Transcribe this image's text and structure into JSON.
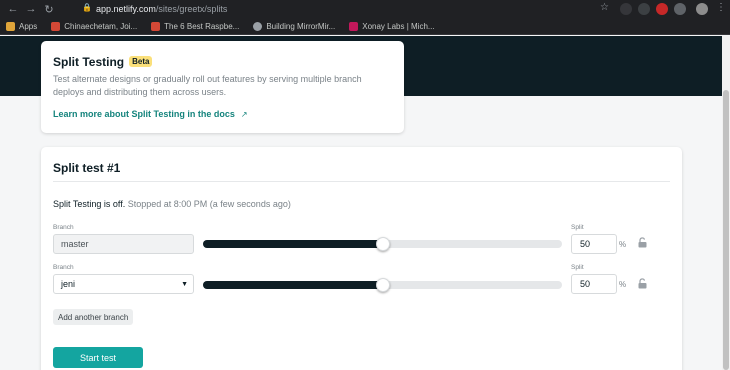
{
  "browser": {
    "url_host": "app.netlify.com",
    "url_path": "/sites/greetx/splits",
    "bookmarks": [
      {
        "label": "Apps",
        "color": "#e0a53a"
      },
      {
        "label": "Chinaechetam, Joi...",
        "color": "#d34836"
      },
      {
        "label": "The 6 Best Raspbe...",
        "color": "#d34836"
      },
      {
        "label": "Building MirrorMir...",
        "color": "#9aa0a6"
      },
      {
        "label": "Xonay Labs | Mich...",
        "color": "#c2185b"
      }
    ]
  },
  "intro": {
    "title": "Split Testing",
    "badge": "Beta",
    "description": "Test alternate designs or gradually roll out features by serving multiple branch deploys and distributing them across users.",
    "link": "Learn more about Split Testing in the docs",
    "link_arrow": "↗"
  },
  "split": {
    "title": "Split test #1",
    "status_strong": "Split Testing is off.",
    "status_detail": "Stopped at 8:00 PM (a few seconds ago)",
    "branch_label": "Branch",
    "split_label": "Split",
    "percent": "%",
    "rows": [
      {
        "branch": "master",
        "split": "50",
        "fraction": 0.5
      },
      {
        "branch": "jeni",
        "split": "50",
        "fraction": 0.5
      }
    ],
    "add_button": "Add another branch",
    "start_button": "Start test"
  },
  "colors": {
    "accent": "#14a5a0",
    "link": "#15847d",
    "hero": "#0e1e25",
    "badge": "#fbe07a"
  }
}
